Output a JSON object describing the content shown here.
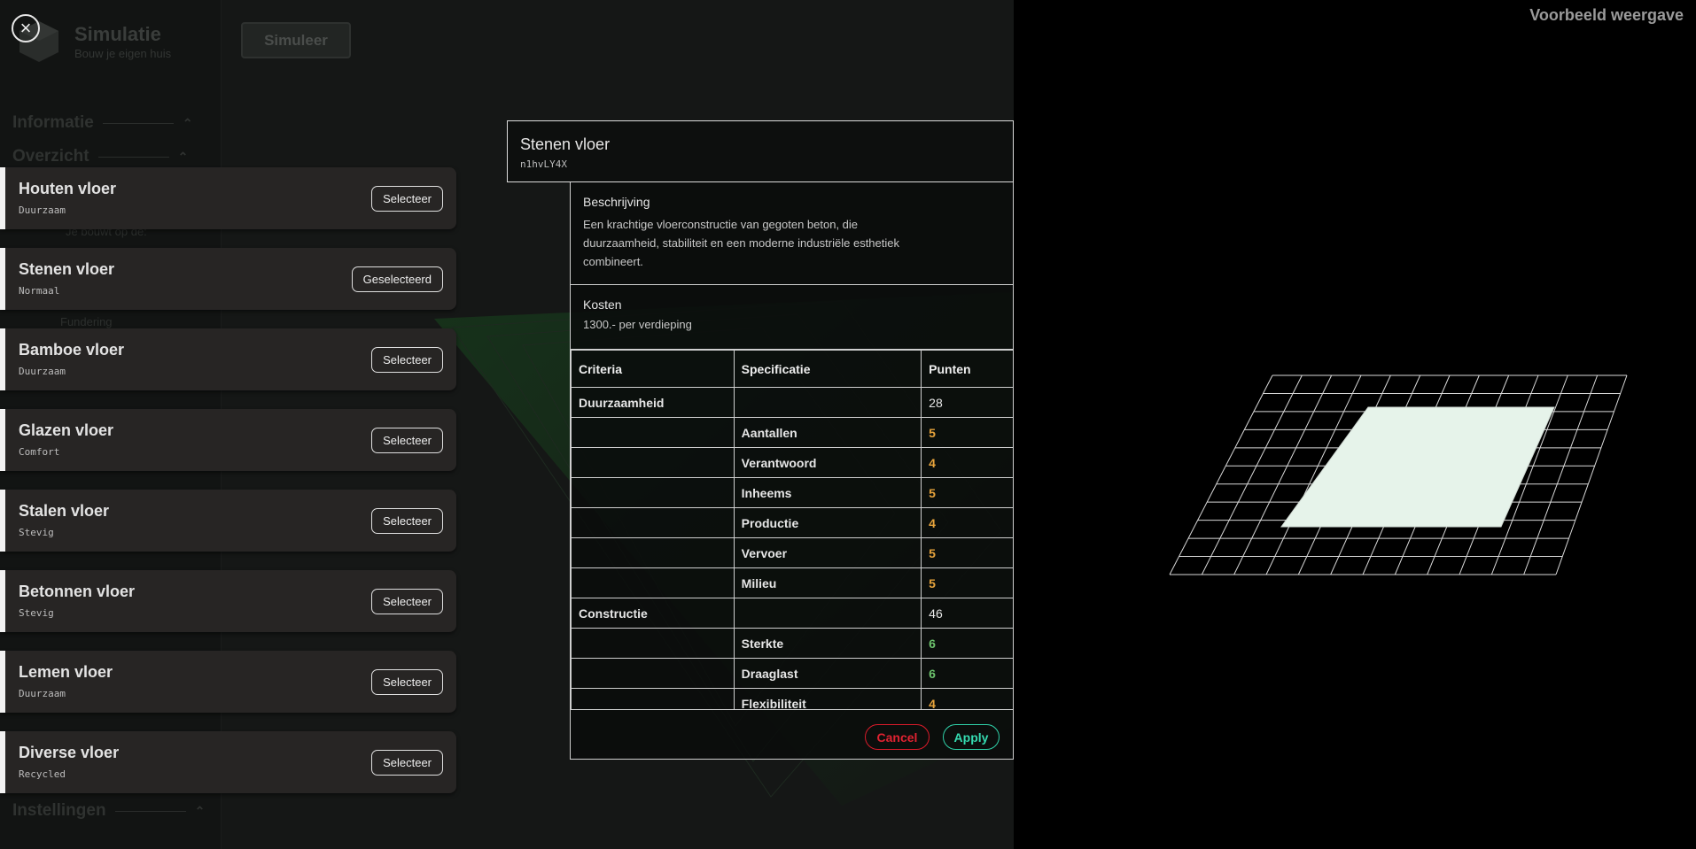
{
  "app": {
    "title": "Simulatie",
    "subtitle": "Bouw je eigen huis",
    "simuleer_label": "Simuleer",
    "sections": {
      "informatie": "Informatie",
      "overzicht": "Overzicht",
      "instellingen": "Instellingen"
    },
    "faint_text": {
      "bouw_op": "Je bouwt op de:",
      "fundering": "Fundering"
    }
  },
  "preview": {
    "title": "Voorbeeld weergave"
  },
  "options": [
    {
      "name": "Houten vloer",
      "category": "Duurzaam",
      "button": "Selecteer"
    },
    {
      "name": "Stenen vloer",
      "category": "Normaal",
      "button": "Geselecteerd"
    },
    {
      "name": "Bamboe vloer",
      "category": "Duurzaam",
      "button": "Selecteer"
    },
    {
      "name": "Glazen vloer",
      "category": "Comfort",
      "button": "Selecteer"
    },
    {
      "name": "Stalen vloer",
      "category": "Stevig",
      "button": "Selecteer"
    },
    {
      "name": "Betonnen vloer",
      "category": "Stevig",
      "button": "Selecteer"
    },
    {
      "name": "Lemen vloer",
      "category": "Duurzaam",
      "button": "Selecteer"
    },
    {
      "name": "Diverse vloer",
      "category": "Recycled",
      "button": "Selecteer"
    }
  ],
  "detail": {
    "title": "Stenen vloer",
    "code": "n1hvLY4X",
    "description_label": "Beschrijving",
    "description": "Een krachtige vloerconstructie van gegoten beton, die duurzaamheid, stabiliteit en een moderne industriële esthetiek combineert.",
    "cost_label": "Kosten",
    "cost": "1300.- per verdieping",
    "table": {
      "headers": [
        "Criteria",
        "Specificatie",
        "Punten"
      ],
      "rows": [
        {
          "criteria": "Duurzaamheid",
          "spec": "",
          "points": "28",
          "kind": "group"
        },
        {
          "criteria": "",
          "spec": "Aantallen",
          "points": "5",
          "kind": "orange"
        },
        {
          "criteria": "",
          "spec": "Verantwoord",
          "points": "4",
          "kind": "orange"
        },
        {
          "criteria": "",
          "spec": "Inheems",
          "points": "5",
          "kind": "orange"
        },
        {
          "criteria": "",
          "spec": "Productie",
          "points": "4",
          "kind": "orange"
        },
        {
          "criteria": "",
          "spec": "Vervoer",
          "points": "5",
          "kind": "orange"
        },
        {
          "criteria": "",
          "spec": "Milieu",
          "points": "5",
          "kind": "orange"
        },
        {
          "criteria": "Constructie",
          "spec": "",
          "points": "46",
          "kind": "group"
        },
        {
          "criteria": "",
          "spec": "Sterkte",
          "points": "6",
          "kind": "green"
        },
        {
          "criteria": "",
          "spec": "Draaglast",
          "points": "6",
          "kind": "green"
        },
        {
          "criteria": "",
          "spec": "Flexibiliteit",
          "points": "4",
          "kind": "orange"
        }
      ]
    },
    "cancel_label": "Cancel",
    "apply_label": "Apply"
  },
  "colors": {
    "cancel": "#d91b2a",
    "apply": "#2fd0a8",
    "points_orange": "#e6a33c",
    "points_green": "#6cc26c"
  }
}
